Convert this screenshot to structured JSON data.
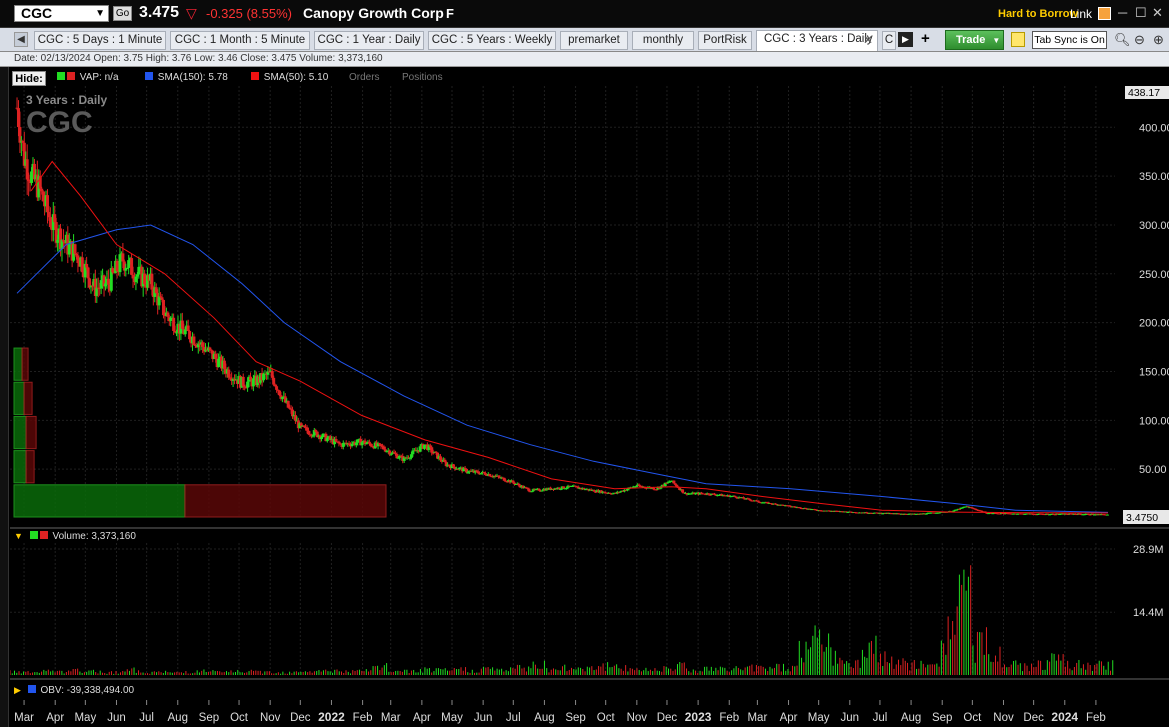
{
  "header": {
    "symbol": "CGC",
    "go_label": "Go",
    "last_price": "3.475",
    "change": "-0.325 (8.55%)",
    "company": "Canopy Growth Corp",
    "flag": "F",
    "hard_to_borrow": "Hard to Borrow",
    "link_label": "Link"
  },
  "tabs": [
    "CGC : 5 Days : 1 Minute",
    "CGC : 1 Month : 5 Minute",
    "CGC : 1 Year : Daily",
    "CGC : 5 Years : Weekly",
    "premarket",
    "monthly",
    "PortRisk",
    "CGC : 3 Years : Daily",
    "C"
  ],
  "toolbar": {
    "trade_label": "Trade",
    "tab_sync_label": "Tab Sync is On"
  },
  "info_line": "Date: 02/13/2024   Open: 3.75   High: 3.76   Low: 3.46   Close: 3.475   Volume: 3,373,160",
  "legend": {
    "hide_label": "Hide:",
    "vap": "VAP: n/a",
    "sma150": "SMA(150): 5.78",
    "sma50": "SMA(50): 5.10",
    "orders": "Orders",
    "positions": "Positions",
    "volume": "Volume: 3,373,160",
    "obv": "OBV: -39,338,494.00"
  },
  "price_panel": {
    "period_label": "3 Years : Daily",
    "watermark": "CGC",
    "top_price_tag": "438.17",
    "last_price_tag": "3.4750"
  },
  "colors": {
    "up": "#22dd22",
    "down": "#dd2222",
    "sma150": "#2255ee",
    "sma50": "#ee1111",
    "grid": "#1f1f1f"
  },
  "chart_data": [
    {
      "type": "line",
      "title": "3 Years : Daily",
      "series": [
        {
          "name": "CGC",
          "points": [
            [
              "2021-02-22",
              420
            ],
            [
              "2021-03-01",
              370
            ],
            [
              "2021-03-08",
              350
            ],
            [
              "2021-03-15",
              340
            ],
            [
              "2021-03-29",
              300
            ],
            [
              "2021-04-12",
              280
            ],
            [
              "2021-04-26",
              265
            ],
            [
              "2021-05-10",
              235
            ],
            [
              "2021-05-24",
              240
            ],
            [
              "2021-06-07",
              265
            ],
            [
              "2021-06-21",
              250
            ],
            [
              "2021-07-05",
              240
            ],
            [
              "2021-07-19",
              210
            ],
            [
              "2021-08-02",
              195
            ],
            [
              "2021-08-16",
              185
            ],
            [
              "2021-09-06",
              165
            ],
            [
              "2021-09-20",
              150
            ],
            [
              "2021-10-04",
              138
            ],
            [
              "2021-10-18",
              140
            ],
            [
              "2021-11-01",
              148
            ],
            [
              "2021-11-15",
              120
            ],
            [
              "2021-12-01",
              92
            ],
            [
              "2021-12-20",
              85
            ],
            [
              "2022-01-10",
              75
            ],
            [
              "2022-01-31",
              78
            ],
            [
              "2022-02-21",
              72
            ],
            [
              "2022-03-14",
              60
            ],
            [
              "2022-04-04",
              75
            ],
            [
              "2022-04-25",
              55
            ],
            [
              "2022-05-16",
              48
            ],
            [
              "2022-06-06",
              45
            ],
            [
              "2022-06-27",
              38
            ],
            [
              "2022-07-18",
              28
            ],
            [
              "2022-08-08",
              30
            ],
            [
              "2022-08-29",
              32
            ],
            [
              "2022-09-19",
              28
            ],
            [
              "2022-10-10",
              25
            ],
            [
              "2022-10-31",
              33
            ],
            [
              "2022-11-21",
              30
            ],
            [
              "2022-12-05",
              38
            ],
            [
              "2022-12-19",
              25
            ],
            [
              "2023-01-09",
              25
            ],
            [
              "2023-02-06",
              22
            ],
            [
              "2023-03-06",
              16
            ],
            [
              "2023-04-03",
              12
            ],
            [
              "2023-05-01",
              8
            ],
            [
              "2023-06-05",
              6
            ],
            [
              "2023-07-03",
              5
            ],
            [
              "2023-08-07",
              4
            ],
            [
              "2023-09-11",
              7
            ],
            [
              "2023-09-25",
              12
            ],
            [
              "2023-10-16",
              5
            ],
            [
              "2023-11-13",
              4.5
            ],
            [
              "2023-12-11",
              4
            ],
            [
              "2024-01-08",
              4.2
            ],
            [
              "2024-02-13",
              3.475
            ]
          ]
        },
        {
          "name": "SMA(150)",
          "points": [
            [
              "2021-02-22",
              230
            ],
            [
              "2021-04-12",
              280
            ],
            [
              "2021-06-01",
              295
            ],
            [
              "2021-07-05",
              300
            ],
            [
              "2021-08-16",
              280
            ],
            [
              "2021-10-04",
              240
            ],
            [
              "2021-11-15",
              200
            ],
            [
              "2022-01-10",
              160
            ],
            [
              "2022-03-14",
              125
            ],
            [
              "2022-05-16",
              95
            ],
            [
              "2022-07-18",
              75
            ],
            [
              "2022-09-19",
              58
            ],
            [
              "2022-11-21",
              45
            ],
            [
              "2023-01-09",
              35
            ],
            [
              "2023-04-03",
              30
            ],
            [
              "2023-07-03",
              22
            ],
            [
              "2023-09-11",
              15
            ],
            [
              "2023-11-13",
              8
            ],
            [
              "2024-02-13",
              5.78
            ]
          ]
        },
        {
          "name": "SMA(50)",
          "points": [
            [
              "2021-03-08",
              335
            ],
            [
              "2021-03-29",
              365
            ],
            [
              "2021-04-26",
              330
            ],
            [
              "2021-06-01",
              280
            ],
            [
              "2021-07-19",
              250
            ],
            [
              "2021-09-06",
              205
            ],
            [
              "2021-10-18",
              160
            ],
            [
              "2021-12-01",
              140
            ],
            [
              "2022-01-31",
              105
            ],
            [
              "2022-04-04",
              80
            ],
            [
              "2022-06-06",
              62
            ],
            [
              "2022-08-08",
              40
            ],
            [
              "2022-10-10",
              30
            ],
            [
              "2022-12-05",
              32
            ],
            [
              "2023-01-09",
              30
            ],
            [
              "2023-03-06",
              22
            ],
            [
              "2023-05-01",
              15
            ],
            [
              "2023-07-03",
              8
            ],
            [
              "2023-09-11",
              6
            ],
            [
              "2023-11-13",
              5.5
            ],
            [
              "2024-02-13",
              5.1
            ]
          ]
        }
      ],
      "ylim": [
        0,
        438.17
      ],
      "yticks": [
        "400.00",
        "350.00",
        "300.00",
        "250.00",
        "200.00",
        "150.00",
        "100.00",
        "50.00"
      ],
      "xticks": [
        "Mar",
        "Apr",
        "May",
        "Jun",
        "Jul",
        "Aug",
        "Sep",
        "Oct",
        "Nov",
        "Dec",
        "2022",
        "Feb",
        "Mar",
        "Apr",
        "May",
        "Jun",
        "Jul",
        "Aug",
        "Sep",
        "Oct",
        "Nov",
        "Dec",
        "2023",
        "Feb",
        "Mar",
        "Apr",
        "May",
        "Jun",
        "Jul",
        "Aug",
        "Sep",
        "Oct",
        "Nov",
        "Dec",
        "2024",
        "Feb"
      ],
      "volume_at_price": [
        {
          "price_low": 0,
          "price_high": 35,
          "up": 170,
          "down": 200
        },
        {
          "price_low": 35,
          "price_high": 70,
          "up": 12,
          "down": 8
        },
        {
          "price_low": 70,
          "price_high": 105,
          "up": 12,
          "down": 10
        },
        {
          "price_low": 105,
          "price_high": 140,
          "up": 10,
          "down": 8
        },
        {
          "price_low": 140,
          "price_high": 175,
          "up": 8,
          "down": 6
        }
      ]
    },
    {
      "type": "bar",
      "title": "Volume",
      "yticks": [
        "28.9M",
        "14.4M"
      ],
      "ylim": [
        0,
        28.9
      ],
      "units": "M",
      "series": [
        {
          "name": "Volume",
          "values": [
            1.2,
            1.0,
            1.3,
            1.1,
            1.5,
            1.2,
            1.0,
            1.8,
            1.1,
            1.0,
            0.9,
            1.2,
            1.4,
            1.0,
            1.3,
            1.2,
            1.1,
            1.0,
            1.5,
            1.3,
            1.6,
            1.2,
            1.4,
            2.8,
            1.5,
            1.3,
            1.8,
            1.6,
            2.0,
            1.7,
            2.2,
            1.9,
            2.5,
            3.8,
            2.1,
            2.4,
            2.8,
            3.2,
            2.6,
            2.3,
            1.9,
            2.8,
            3.5,
            1.7,
            2.2,
            2.0,
            2.4,
            2.6,
            3.0,
            2.8,
            9.5,
            14.0,
            6.5,
            4.0,
            12.0,
            5.5,
            4.0,
            3.5,
            3.0,
            16.5,
            28.9,
            11.0,
            7.0,
            3.5,
            3.0,
            4.0,
            5.0,
            3.5,
            3.0,
            3.4
          ]
        }
      ]
    }
  ]
}
